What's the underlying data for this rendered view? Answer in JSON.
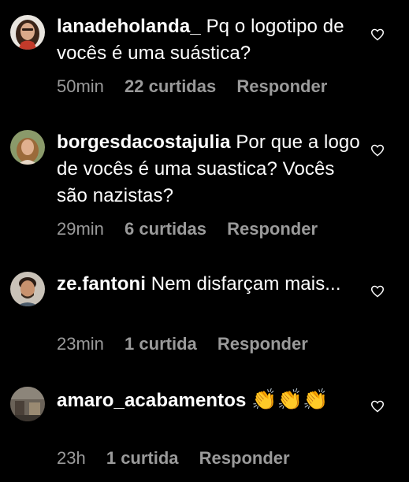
{
  "comments": [
    {
      "username": "lanadeholanda_",
      "text": "Pq o logotipo de vocês é uma suástica?",
      "time": "50min",
      "likes": "22 curtidas",
      "reply": "Responder"
    },
    {
      "username": "borgesdacostajulia",
      "text": "Por que a logo de vocês é uma suastica? Vocês são nazistas?",
      "time": "29min",
      "likes": "6 curtidas",
      "reply": "Responder"
    },
    {
      "username": "ze.fantoni",
      "text": "Nem disfarçam mais...",
      "time": "23min",
      "likes": "1 curtida",
      "reply": "Responder"
    },
    {
      "username": "amaro_acabamentos",
      "text": "👏👏👏",
      "time": "23h",
      "likes": "1 curtida",
      "reply": "Responder"
    }
  ],
  "colors": {
    "background": "#000000",
    "text": "#ffffff",
    "meta": "#9a9a9a"
  }
}
